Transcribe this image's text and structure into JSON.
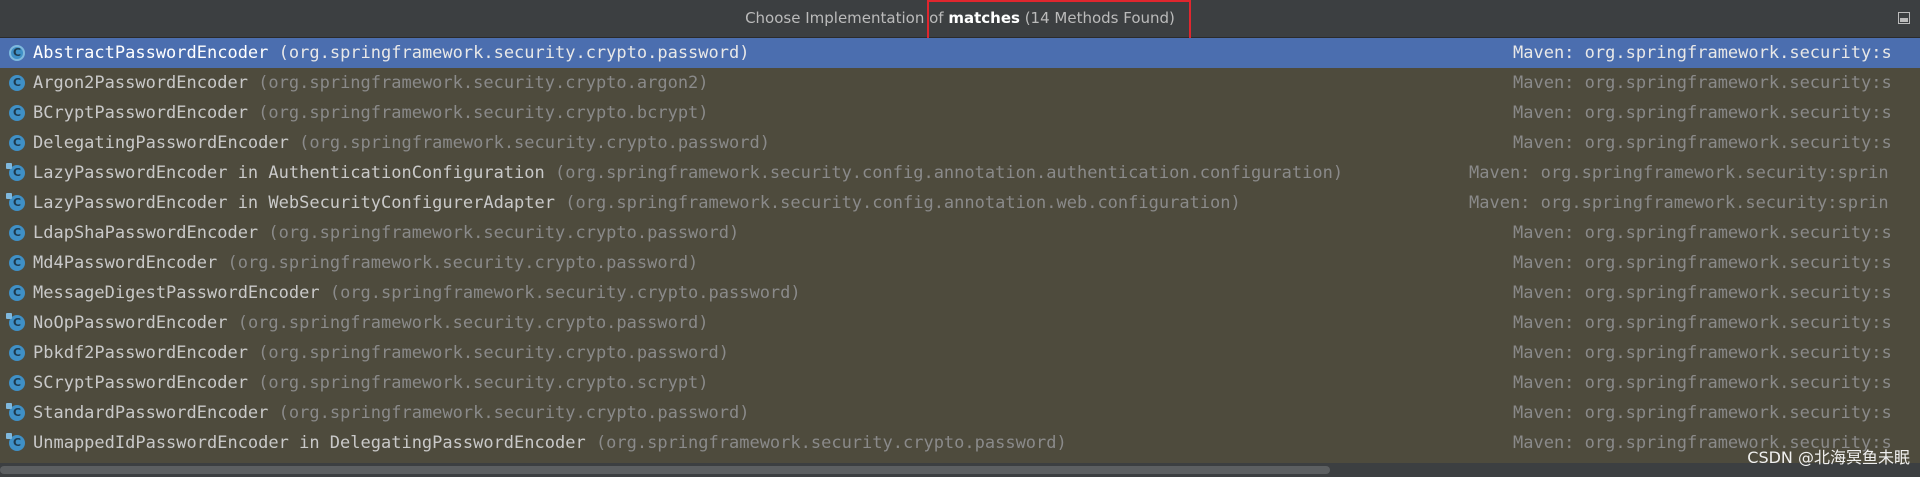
{
  "title": {
    "prefix": "Choose Implementation of ",
    "method": "matches",
    "suffix": " (14 Methods Found)"
  },
  "rows": [
    {
      "name": "AbstractPasswordEncoder",
      "pkg": "(org.springframework.security.crypto.password)",
      "maven": "Maven: org.springframework.security:s",
      "icon": "abstract-class-icon"
    },
    {
      "name": "Argon2PasswordEncoder",
      "pkg": "(org.springframework.security.crypto.argon2)",
      "maven": "Maven: org.springframework.security:s",
      "icon": "class-icon"
    },
    {
      "name": "BCryptPasswordEncoder",
      "pkg": "(org.springframework.security.crypto.bcrypt)",
      "maven": "Maven: org.springframework.security:s",
      "icon": "class-icon"
    },
    {
      "name": "DelegatingPasswordEncoder",
      "pkg": "(org.springframework.security.crypto.password)",
      "maven": "Maven: org.springframework.security:s",
      "icon": "class-icon"
    },
    {
      "name": "LazyPasswordEncoder in AuthenticationConfiguration",
      "pkg": "(org.springframework.security.config.annotation.authentication.configuration)",
      "maven": "Maven: org.springframework.security:sprin",
      "icon": "inner-class-icon"
    },
    {
      "name": "LazyPasswordEncoder in WebSecurityConfigurerAdapter",
      "pkg": "(org.springframework.security.config.annotation.web.configuration)",
      "maven": "Maven: org.springframework.security:sprin",
      "icon": "inner-class-icon"
    },
    {
      "name": "LdapShaPasswordEncoder",
      "pkg": "(org.springframework.security.crypto.password)",
      "maven": "Maven: org.springframework.security:s",
      "icon": "class-icon"
    },
    {
      "name": "Md4PasswordEncoder",
      "pkg": "(org.springframework.security.crypto.password)",
      "maven": "Maven: org.springframework.security:s",
      "icon": "class-icon"
    },
    {
      "name": "MessageDigestPasswordEncoder",
      "pkg": "(org.springframework.security.crypto.password)",
      "maven": "Maven: org.springframework.security:s",
      "icon": "class-icon"
    },
    {
      "name": "NoOpPasswordEncoder",
      "pkg": "(org.springframework.security.crypto.password)",
      "maven": "Maven: org.springframework.security:s",
      "icon": "deprecated-class-icon"
    },
    {
      "name": "Pbkdf2PasswordEncoder",
      "pkg": "(org.springframework.security.crypto.password)",
      "maven": "Maven: org.springframework.security:s",
      "icon": "class-icon"
    },
    {
      "name": "SCryptPasswordEncoder",
      "pkg": "(org.springframework.security.crypto.scrypt)",
      "maven": "Maven: org.springframework.security:s",
      "icon": "class-icon"
    },
    {
      "name": "StandardPasswordEncoder",
      "pkg": "(org.springframework.security.crypto.password)",
      "maven": "Maven: org.springframework.security:s",
      "icon": "deprecated-class-icon"
    },
    {
      "name": "UnmappedIdPasswordEncoder in DelegatingPasswordEncoder",
      "pkg": "(org.springframework.security.crypto.password)",
      "maven": "Maven: org.springframework.security:s",
      "icon": "inner-class-icon"
    }
  ],
  "watermark": "CSDN @北海冥鱼未眠",
  "colors": {
    "selected_row": "#4b6eaf",
    "highlight_box": "#e0262e",
    "class_icon": "#3f90c6"
  }
}
